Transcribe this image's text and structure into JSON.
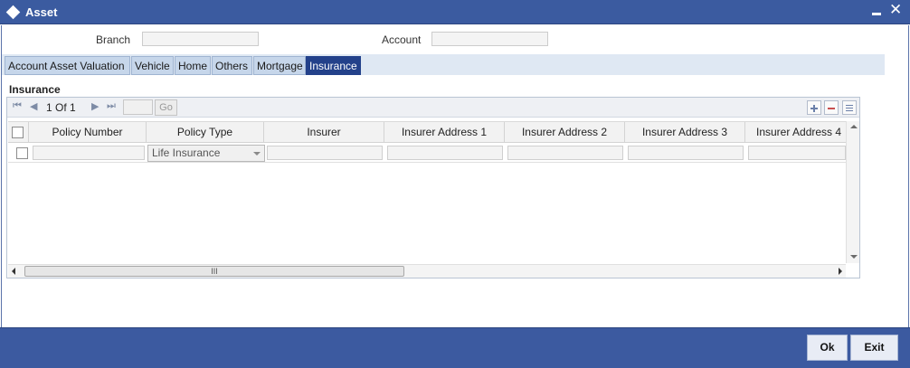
{
  "window": {
    "title": "Asset",
    "close_glyph": "✕"
  },
  "form": {
    "branch_label": "Branch",
    "branch_value": "",
    "account_label": "Account",
    "account_value": ""
  },
  "tabs": [
    {
      "label": "Account Asset Valuation"
    },
    {
      "label": "Vehicle"
    },
    {
      "label": "Home"
    },
    {
      "label": "Others"
    },
    {
      "label": "Mortgage"
    },
    {
      "label": "Insurance",
      "active": true
    }
  ],
  "section": {
    "title": "Insurance"
  },
  "grid": {
    "pager": {
      "text": "1 Of 1",
      "first_glyph": "⏮",
      "prev_glyph": "◀",
      "next_glyph": "▶",
      "last_glyph": "⏭",
      "page_input": "",
      "go_label": "Go"
    },
    "columns": [
      "Policy Number",
      "Policy Type",
      "Insurer",
      "Insurer Address 1",
      "Insurer Address 2",
      "Insurer Address 3",
      "Insurer Address 4"
    ],
    "rows": [
      {
        "policy_number": "",
        "policy_type": "Life Insurance",
        "insurer": "",
        "address1": "",
        "address2": "",
        "address3": "",
        "address4": ""
      }
    ],
    "hscroll_thumb": "III"
  },
  "footer": {
    "ok_label": "Ok",
    "exit_label": "Exit"
  },
  "colors": {
    "titlebar": "#3b5ba0",
    "active_tab": "#23418a",
    "footer": "#3c5aa0"
  }
}
